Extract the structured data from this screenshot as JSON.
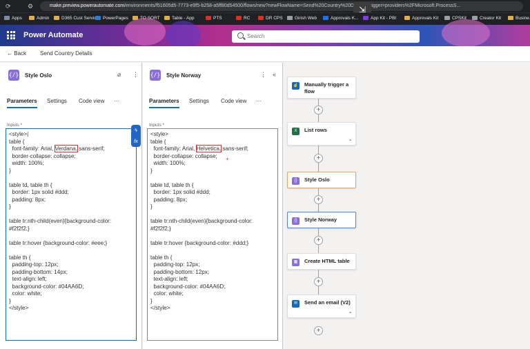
{
  "browser": {
    "url_host": "make.preview.powerautomate.com",
    "url_path": "/environments/f51605d5-7773-e9f5-b258-a5ff80d54500/flows/new?newFlowName=Send%20Country%20Details&trigger=providers%2FMicrosoft.ProcessS...",
    "bookmarks": [
      "Apps",
      "Admin",
      "D365 Cust Service",
      "PowerPages",
      "TO SORT",
      "Table - App",
      "PTS",
      "RC",
      "DR CPS",
      "Girish Web",
      "Approvals K...",
      "App Kit - PBI",
      "Approvals Kit",
      "CPSKit",
      "Creator Kit",
      "Busine..."
    ]
  },
  "header": {
    "app_title": "Power Automate",
    "search_placeholder": "Search"
  },
  "command_bar": {
    "back_label": "Back",
    "flow_name": "Send Country Details"
  },
  "panel_oslo": {
    "title": "Style Oslo",
    "tabs": [
      "Parameters",
      "Settings",
      "Code view",
      "···"
    ],
    "inputs_label": "Inputs *",
    "lines": [
      {
        "a": "<style>|",
        "h": "",
        "b": ""
      },
      {
        "a": "table {",
        "h": "",
        "b": ""
      },
      {
        "a": "  font-family: Arial, ",
        "h": "Verdana,",
        "b": " sans-serif;"
      },
      {
        "a": "  border-collapse: collapse;",
        "h": "",
        "b": ""
      },
      {
        "a": "  width: 100%;",
        "h": "",
        "b": ""
      },
      {
        "a": "}",
        "h": "",
        "b": ""
      },
      {
        "a": "",
        "h": "",
        "b": ""
      },
      {
        "a": "table td, table th {",
        "h": "",
        "b": ""
      },
      {
        "a": "  border: 1px solid #ddd;",
        "h": "",
        "b": ""
      },
      {
        "a": "  padding: 8px;",
        "h": "",
        "b": ""
      },
      {
        "a": "}",
        "h": "",
        "b": ""
      },
      {
        "a": "",
        "h": "",
        "b": ""
      },
      {
        "a": "table tr:nth-child(even){background-color:",
        "h": "",
        "b": ""
      },
      {
        "a": "#f2f2f2;}",
        "h": "",
        "b": ""
      },
      {
        "a": "",
        "h": "",
        "b": ""
      },
      {
        "a": "table tr:hover {background-color: #eee;}",
        "h": "",
        "b": ""
      },
      {
        "a": "",
        "h": "",
        "b": ""
      },
      {
        "a": "table th {",
        "h": "",
        "b": ""
      },
      {
        "a": "  padding-top: 12px;",
        "h": "",
        "b": ""
      },
      {
        "a": "  padding-bottom: 14px;",
        "h": "",
        "b": ""
      },
      {
        "a": "  text-align: left;",
        "h": "",
        "b": ""
      },
      {
        "a": "  background-color: #04AA6D;",
        "h": "",
        "b": ""
      },
      {
        "a": "  color: white;",
        "h": "",
        "b": ""
      },
      {
        "a": "}",
        "h": "",
        "b": ""
      },
      {
        "a": "</style>",
        "h": "",
        "b": ""
      }
    ]
  },
  "panel_norway": {
    "title": "Style Norway",
    "tabs": [
      "Parameters",
      "Settings",
      "Code view",
      "···"
    ],
    "inputs_label": "Inputs *",
    "lines": [
      {
        "a": "<style>",
        "h": "",
        "b": ""
      },
      {
        "a": "table {",
        "h": "",
        "b": ""
      },
      {
        "a": "  font-family: Arial, ",
        "h": "Helvetica,",
        "b": " sans-serif;"
      },
      {
        "a": "  border-collapse: collapse;",
        "h": "",
        "b": ""
      },
      {
        "a": "  width: 100%;",
        "h": "",
        "b": ""
      },
      {
        "a": "}",
        "h": "",
        "b": ""
      },
      {
        "a": "",
        "h": "",
        "b": ""
      },
      {
        "a": "table td, table th {",
        "h": "",
        "b": ""
      },
      {
        "a": "  border: 1px solid #ddd;",
        "h": "",
        "b": ""
      },
      {
        "a": "  padding: 8px;",
        "h": "",
        "b": ""
      },
      {
        "a": "}",
        "h": "",
        "b": ""
      },
      {
        "a": "",
        "h": "",
        "b": ""
      },
      {
        "a": "table tr:nth-child(even){background-color:",
        "h": "",
        "b": ""
      },
      {
        "a": "#f2f2f2;}",
        "h": "",
        "b": ""
      },
      {
        "a": "",
        "h": "",
        "b": ""
      },
      {
        "a": "table tr:hover {background-color: #ddd;}",
        "h": "",
        "b": ""
      },
      {
        "a": "",
        "h": "",
        "b": ""
      },
      {
        "a": "table th {",
        "h": "",
        "b": ""
      },
      {
        "a": "  padding-top: 12px;",
        "h": "",
        "b": ""
      },
      {
        "a": "  padding-bottom: 12px;",
        "h": "",
        "b": ""
      },
      {
        "a": "  text-align: left;",
        "h": "",
        "b": ""
      },
      {
        "a": "  background-color: #04AA6D;",
        "h": "",
        "b": ""
      },
      {
        "a": "  color: white;",
        "h": "",
        "b": ""
      },
      {
        "a": "}",
        "h": "",
        "b": ""
      },
      {
        "a": "</style>",
        "h": "",
        "b": ""
      }
    ]
  },
  "flow": {
    "steps": [
      {
        "label": "Manually trigger a flow",
        "icon": "hand-trigger-icon",
        "color": "#0f6cbd",
        "selected": "",
        "linked": false
      },
      {
        "label": "List rows",
        "icon": "excel-icon",
        "color": "#1e7145",
        "selected": "",
        "linked": true
      },
      {
        "label": "Style Oslo",
        "icon": "compose-icon",
        "color": "#8b6fd8",
        "selected": "orange",
        "linked": false
      },
      {
        "label": "Style Norway",
        "icon": "compose-icon",
        "color": "#8b6fd8",
        "selected": "blue",
        "linked": false
      },
      {
        "label": "Create HTML table",
        "icon": "html-table-icon",
        "color": "#8b6fd8",
        "selected": "",
        "linked": false
      },
      {
        "label": "Send an email (V2)",
        "icon": "outlook-icon",
        "color": "#0f6cbd",
        "selected": "",
        "linked": true
      }
    ]
  }
}
